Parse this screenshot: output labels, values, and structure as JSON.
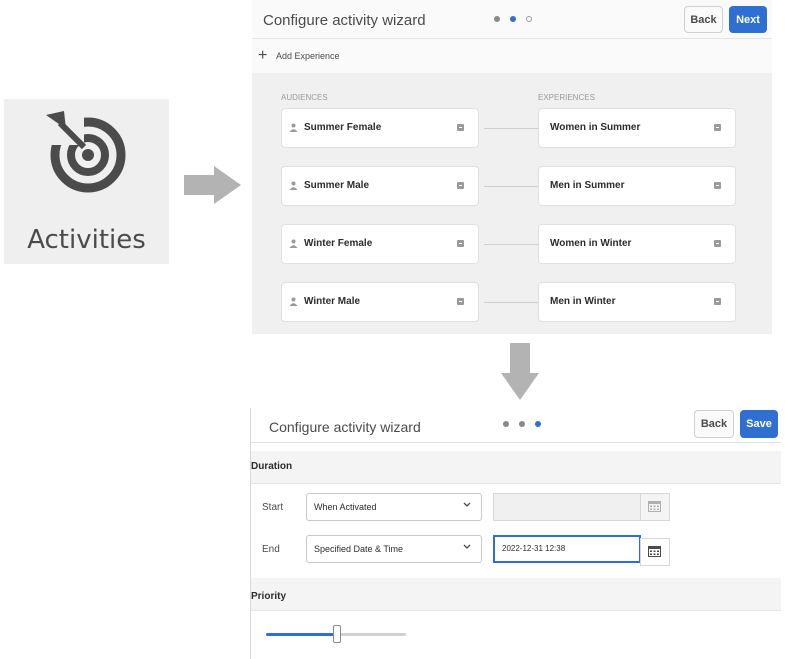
{
  "tile": {
    "label": "Activities",
    "icon": "target-icon"
  },
  "wizard1": {
    "title": "Configure activity wizard",
    "steps": 3,
    "current_step": 2,
    "back_label": "Back",
    "next_label": "Next",
    "add_experience_label": "Add Experience",
    "audiences_header": "AUDIENCES",
    "experiences_header": "EXPERIENCES",
    "rows": [
      {
        "audience": "Summer Female",
        "experience": "Women in Summer"
      },
      {
        "audience": "Summer Male",
        "experience": "Men in Summer"
      },
      {
        "audience": "Winter Female",
        "experience": "Women in Winter"
      },
      {
        "audience": "Winter Male",
        "experience": "Men in Winter"
      }
    ]
  },
  "wizard2": {
    "title": "Configure activity wizard",
    "steps": 3,
    "current_step": 3,
    "back_label": "Back",
    "save_label": "Save",
    "duration_label": "Duration",
    "start_label": "Start",
    "start_value": "When Activated",
    "start_date": "",
    "end_label": "End",
    "end_value": "Specified Date & Time",
    "end_date": "2022-12-31 12:38",
    "priority_label": "Priority",
    "priority_fraction": 0.5
  },
  "colors": {
    "accent": "#2f6fd1",
    "arrow": "#b3b3b3",
    "icon": "#4b4b4b"
  }
}
